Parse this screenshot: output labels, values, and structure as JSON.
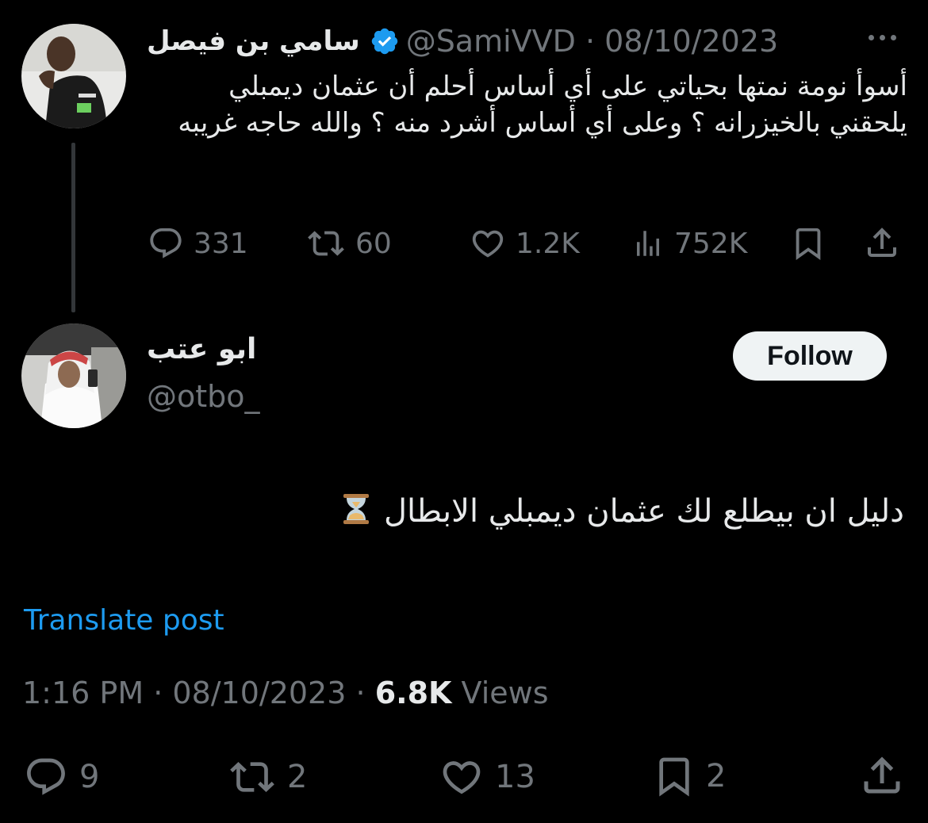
{
  "parent": {
    "name": "سامي بن فيصل",
    "handle": "@SamiVVD",
    "date": "08/10/2023",
    "text": "أسوأ نومة نمتها بحياتي على أي أساس أحلم أن عثمان ديمبلي يلحقني بالخيزرانه ؟ وعلى أي أساس أشرد منه ؟ والله حاجه غريبه",
    "replies": "331",
    "reposts": "60",
    "likes": "1.2K",
    "views": "752K"
  },
  "reply": {
    "name": "ابو عتب",
    "handle": "@otbo_",
    "follow_label": "Follow",
    "text": "دليل ان بيطلع لك عثمان ديمبلي الابطال",
    "translate_label": "Translate post",
    "time": "1:16 PM",
    "date": "08/10/2023",
    "views_count": "6.8K",
    "views_label": "Views",
    "replies": "9",
    "reposts": "2",
    "likes": "13",
    "bookmarks": "2"
  },
  "colors": {
    "background": "#000000",
    "text": "#e7e9ea",
    "muted": "#71767b",
    "link": "#1d9bf0",
    "verified": "#1d9bf0"
  }
}
